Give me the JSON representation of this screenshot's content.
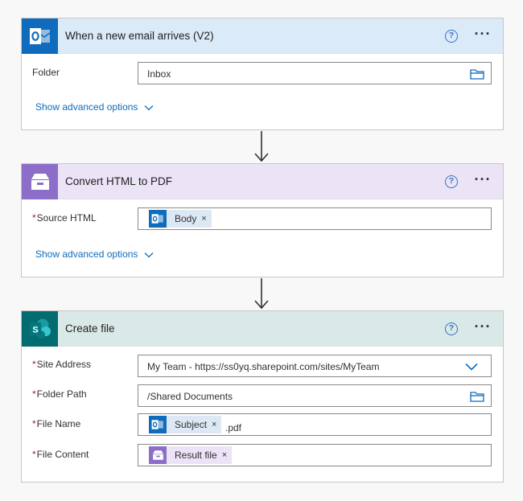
{
  "colors": {
    "outlook_blue": "#0f6cbd",
    "outlook_header": "#daeaf8",
    "pdf_purple": "#8c6dc8",
    "pdf_header": "#ebe3f6",
    "sharepoint_teal": "#036c70",
    "sharepoint_header": "#d9e9e8",
    "link_blue": "#0f6cbd",
    "required_red": "#a4262c"
  },
  "trigger": {
    "icon": "outlook-icon",
    "title": "When a new email arrives (V2)",
    "folder_label": "Folder",
    "folder_value": "Inbox",
    "advanced_label": "Show advanced options"
  },
  "convert": {
    "icon": "archive-box-icon",
    "title": "Convert HTML to PDF",
    "required_mark": "*",
    "source_label": "Source HTML",
    "source_token": "Body",
    "advanced_label": "Show advanced options"
  },
  "create": {
    "icon": "sharepoint-icon",
    "title": "Create file",
    "required_mark": "*",
    "site_label": "Site Address",
    "site_value": "My Team - https://ss0yq.sharepoint.com/sites/MyTeam",
    "folder_label": "Folder Path",
    "folder_value": "/Shared Documents",
    "name_label": "File Name",
    "name_token": "Subject",
    "name_suffix": ".pdf",
    "content_label": "File Content",
    "content_token": "Result file"
  },
  "token_remove": "×",
  "help_glyph": "?",
  "more_glyph": "···"
}
